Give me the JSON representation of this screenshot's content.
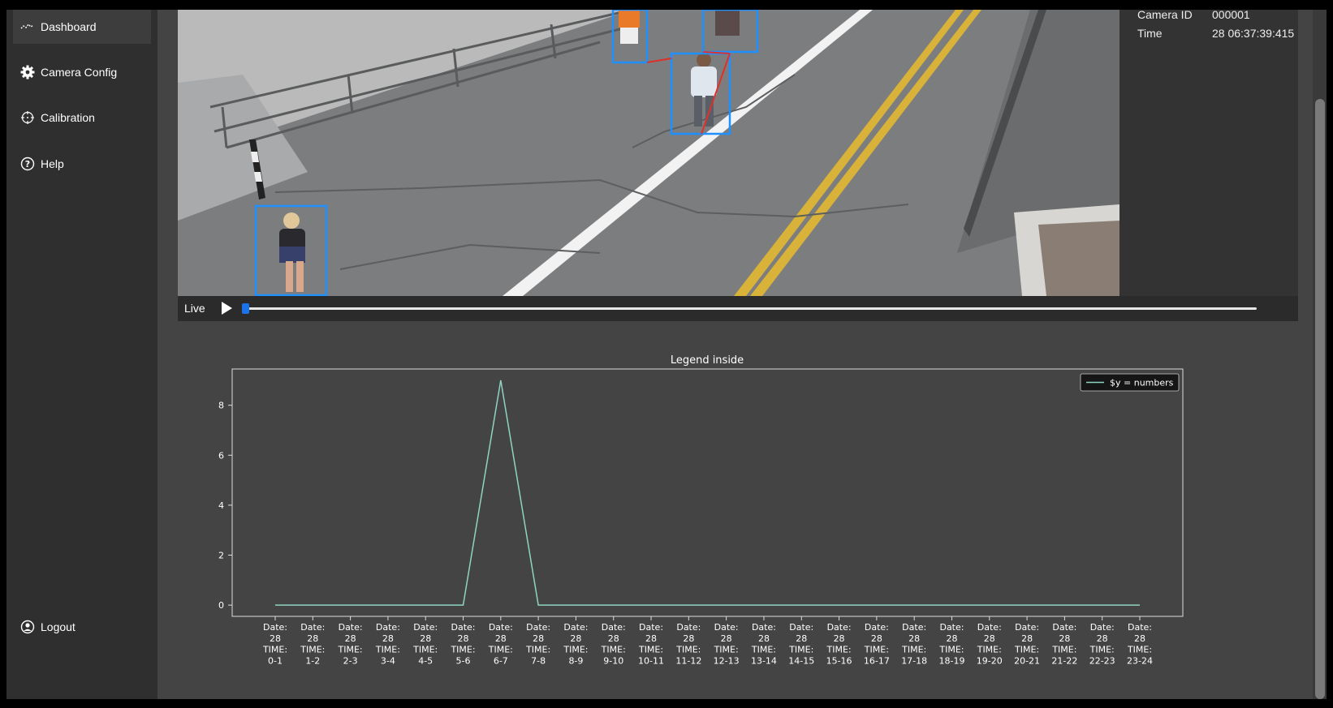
{
  "sidebar": {
    "items": [
      {
        "label": "Dashboard",
        "icon": "activity-icon",
        "active": true
      },
      {
        "label": "Camera Config",
        "icon": "gear-icon"
      },
      {
        "label": "Calibration",
        "icon": "crosshair-icon"
      },
      {
        "label": "Help",
        "icon": "help-circle-icon"
      }
    ],
    "logout": {
      "label": "Logout",
      "icon": "user-circle-icon"
    }
  },
  "info": {
    "camera_id_label": "Camera ID",
    "camera_id_value": "000001",
    "time_label": "Time",
    "time_value": "28 06:37:39:415"
  },
  "player": {
    "live_label": "Live",
    "progress": 0.0
  },
  "colors": {
    "line": "#8fd4c2",
    "bbox": "#1e90ff",
    "link": "#e0302a",
    "panel": "#444444"
  },
  "chart_data": {
    "type": "line",
    "title": "Legend inside",
    "xlabel": "",
    "ylabel": "",
    "categories": [
      "Date:\n28\nTIME:\n0-1",
      "Date:\n28\nTIME:\n1-2",
      "Date:\n28\nTIME:\n2-3",
      "Date:\n28\nTIME:\n3-4",
      "Date:\n28\nTIME:\n4-5",
      "Date:\n28\nTIME:\n5-6",
      "Date:\n28\nTIME:\n6-7",
      "Date:\n28\nTIME:\n7-8",
      "Date:\n28\nTIME:\n8-9",
      "Date:\n28\nTIME:\n9-10",
      "Date:\n28\nTIME:\n10-11",
      "Date:\n28\nTIME:\n11-12",
      "Date:\n28\nTIME:\n12-13",
      "Date:\n28\nTIME:\n13-14",
      "Date:\n28\nTIME:\n14-15",
      "Date:\n28\nTIME:\n15-16",
      "Date:\n28\nTIME:\n16-17",
      "Date:\n28\nTIME:\n17-18",
      "Date:\n28\nTIME:\n18-19",
      "Date:\n28\nTIME:\n19-20",
      "Date:\n28\nTIME:\n20-21",
      "Date:\n28\nTIME:\n21-22",
      "Date:\n28\nTIME:\n22-23",
      "Date:\n28\nTIME:\n23-24"
    ],
    "series": [
      {
        "name": "$y = numbers",
        "values": [
          0,
          0,
          0,
          0,
          0,
          0,
          9,
          0,
          0,
          0,
          0,
          0,
          0,
          0,
          0,
          0,
          0,
          0,
          0,
          0,
          0,
          0,
          0,
          0
        ]
      }
    ],
    "yticks": [
      0,
      2,
      4,
      6,
      8
    ],
    "ylim": [
      -0.45,
      9.45
    ],
    "grid": false,
    "legend": "top-right"
  }
}
